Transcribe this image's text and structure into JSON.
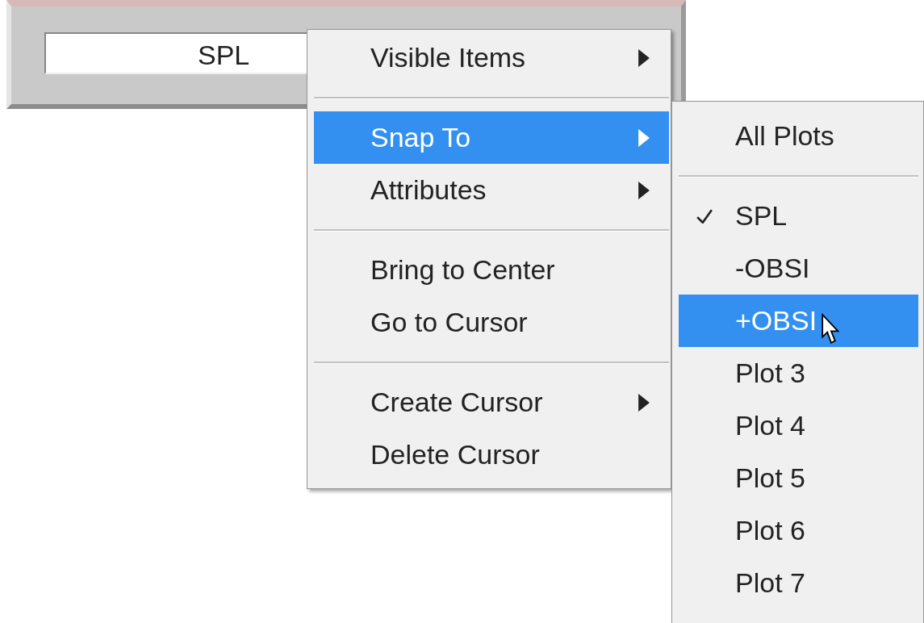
{
  "control": {
    "label": "SPL"
  },
  "menu": {
    "items": [
      {
        "kind": "item",
        "label": "Visible Items",
        "has_submenu": true,
        "selected": false
      },
      {
        "kind": "separator"
      },
      {
        "kind": "item",
        "label": "Snap To",
        "has_submenu": true,
        "selected": true
      },
      {
        "kind": "item",
        "label": "Attributes",
        "has_submenu": true,
        "selected": false
      },
      {
        "kind": "separator"
      },
      {
        "kind": "item",
        "label": "Bring to Center",
        "has_submenu": false,
        "selected": false
      },
      {
        "kind": "item",
        "label": "Go to Cursor",
        "has_submenu": false,
        "selected": false
      },
      {
        "kind": "separator"
      },
      {
        "kind": "item",
        "label": "Create Cursor",
        "has_submenu": true,
        "selected": false
      },
      {
        "kind": "item",
        "label": "Delete Cursor",
        "has_submenu": false,
        "selected": false
      }
    ]
  },
  "submenu": {
    "items": [
      {
        "kind": "item",
        "label": "All Plots",
        "checked": false,
        "selected": false
      },
      {
        "kind": "separator"
      },
      {
        "kind": "item",
        "label": "SPL",
        "checked": true,
        "selected": false
      },
      {
        "kind": "item",
        "label": "-OBSI",
        "checked": false,
        "selected": false
      },
      {
        "kind": "item",
        "label": "+OBSI",
        "checked": false,
        "selected": true
      },
      {
        "kind": "item",
        "label": "Plot 3",
        "checked": false,
        "selected": false
      },
      {
        "kind": "item",
        "label": "Plot 4",
        "checked": false,
        "selected": false
      },
      {
        "kind": "item",
        "label": "Plot 5",
        "checked": false,
        "selected": false
      },
      {
        "kind": "item",
        "label": "Plot 6",
        "checked": false,
        "selected": false
      },
      {
        "kind": "item",
        "label": "Plot 7",
        "checked": false,
        "selected": false
      }
    ]
  }
}
